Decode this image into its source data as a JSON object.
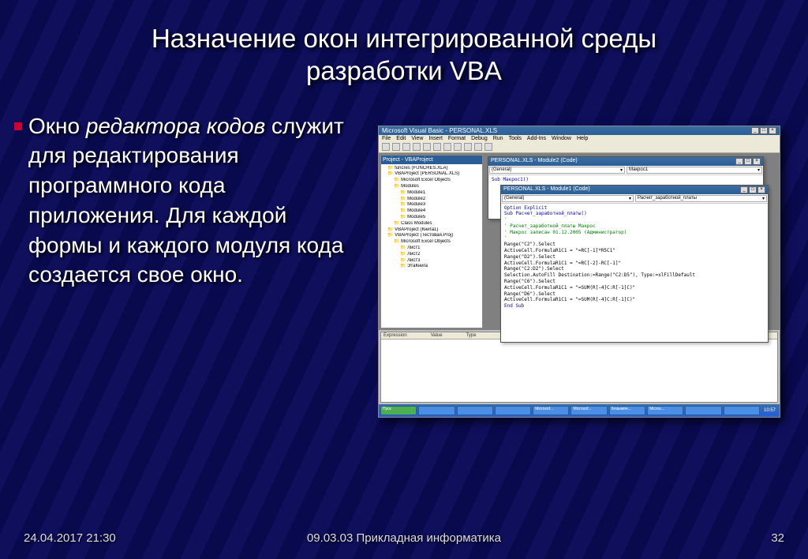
{
  "title_line1": "Назначение окон интегрированной среды",
  "title_line2": "разработки VBA",
  "body_prefix": "Окно ",
  "body_italic": "редактора кодов",
  "body_rest": " служит для редактирования программного кода приложения. Для каждой формы и каждого модуля кода создается свое окно.",
  "footer": {
    "date": "24.04.2017 21:30",
    "center": "09.03.03 Прикладная информатика",
    "page": "32"
  },
  "vba": {
    "app_title": "Microsoft Visual Basic - PERSONAL.XLS",
    "menu": [
      "File",
      "Edit",
      "View",
      "Insert",
      "Format",
      "Debug",
      "Run",
      "Tools",
      "Add-Ins",
      "Window",
      "Help"
    ],
    "tree_header": "Project - VBAProject",
    "tree": [
      {
        "t": "funcres (FUNCRES.XLA)",
        "l": 1
      },
      {
        "t": "VBAProject (PERSONAL.XLS)",
        "l": 1
      },
      {
        "t": "Microsoft Excel Objects",
        "l": 2
      },
      {
        "t": "Modules",
        "l": 2
      },
      {
        "t": "Module1",
        "l": 3
      },
      {
        "t": "Module2",
        "l": 3
      },
      {
        "t": "Module3",
        "l": 3
      },
      {
        "t": "Module4",
        "l": 3
      },
      {
        "t": "Module5",
        "l": 3
      },
      {
        "t": "Class Modules",
        "l": 2
      },
      {
        "t": "VBAProject (Книга1)",
        "l": 1
      },
      {
        "t": "VBAProject (Тестовая.Proj)",
        "l": 1
      },
      {
        "t": "Microsoft Excel Objects",
        "l": 2
      },
      {
        "t": "Лист1",
        "l": 3
      },
      {
        "t": "Лист2",
        "l": 3
      },
      {
        "t": "Лист3",
        "l": 3
      },
      {
        "t": "ЭтаКнига",
        "l": 3
      }
    ],
    "win1": {
      "title": "PERSONAL.XLS - Module2 (Code)",
      "left_drop": "(General)",
      "right_drop": "Макрос1",
      "line1": "Sub Макрос1()"
    },
    "win2": {
      "title": "PERSONAL.XLS - Module1 (Code)",
      "left_drop": "(General)",
      "right_drop": "Расчет_заработной_платы",
      "code": [
        {
          "txt": "Option Explicit",
          "cls": "kw"
        },
        {
          "txt": "Sub Расчет_заработной_платы()",
          "cls": "kw"
        },
        {
          "txt": "'",
          "cls": "cm"
        },
        {
          "txt": "' Расчет_заработной_платы Макрос",
          "cls": "cm"
        },
        {
          "txt": "' Макрос записан 01.12.2005 (Администратор)",
          "cls": "cm"
        },
        {
          "txt": "'",
          "cls": "cm"
        },
        {
          "txt": "    Range(\"C2\").Select",
          "cls": ""
        },
        {
          "txt": "    ActiveCell.FormulaR1C1 = \"=RC[-1]*R5C1\"",
          "cls": ""
        },
        {
          "txt": "    Range(\"D2\").Select",
          "cls": ""
        },
        {
          "txt": "    ActiveCell.FormulaR1C1 = \"=RC[-2]-RC[-1]\"",
          "cls": ""
        },
        {
          "txt": "    Range(\"C2:D2\").Select",
          "cls": ""
        },
        {
          "txt": "    Selection.AutoFill Destination:=Range(\"C2:D5\"), Type:=xlFillDefault",
          "cls": ""
        },
        {
          "txt": "    Range(\"C6\").Select",
          "cls": ""
        },
        {
          "txt": "    ActiveCell.FormulaR1C1 = \"=SUM(R[-4]C:R[-1]C)\"",
          "cls": ""
        },
        {
          "txt": "    Range(\"D6\").Select",
          "cls": ""
        },
        {
          "txt": "    ActiveCell.FormulaR1C1 = \"=SUM(R[-4]C:R[-1]C)\"",
          "cls": ""
        },
        {
          "txt": "End Sub",
          "cls": "kw"
        }
      ]
    },
    "watch_cols": [
      "Expression",
      "Value",
      "Type"
    ],
    "taskbar": [
      "Пуск",
      "",
      "",
      "",
      "Microsof...",
      "Microsof...",
      "Безымян...",
      "Micros...",
      "",
      ""
    ],
    "clock": "10:57"
  }
}
